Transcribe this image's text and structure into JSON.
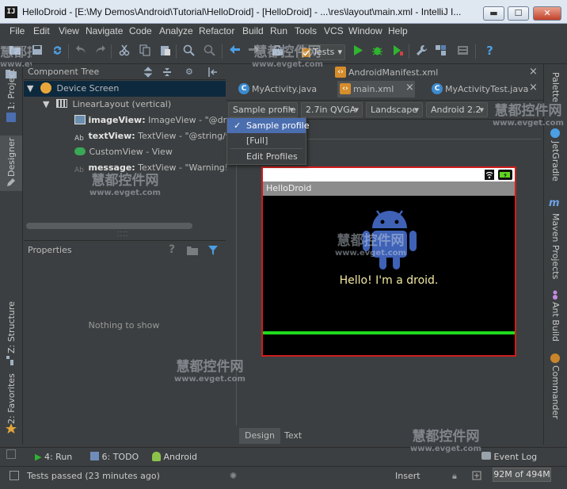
{
  "window": {
    "title": "HelloDroid - [E:\\My Demos\\Android\\Tutorial\\HelloDroid] - [HelloDroid] - ...\\res\\layout\\main.xml - IntelliJ I...",
    "app_icon_text": "IJ",
    "minimize": "▬",
    "maximize": "☐",
    "close": "✕"
  },
  "menu": [
    "File",
    "Edit",
    "View",
    "Navigate",
    "Code",
    "Analyze",
    "Refactor",
    "Build",
    "Run",
    "Tools",
    "VCS",
    "Window",
    "Help"
  ],
  "toolbar": {
    "run_config": "Tests",
    "help_icon": "?"
  },
  "left_strip": {
    "project": "1: Project",
    "designer": "Designer",
    "structure": "Z: Structure",
    "favorites": "2: Favorites"
  },
  "right_strip": {
    "palette": "Palette",
    "jetgradle": "JetGradle",
    "maven": "Maven Projects",
    "ant": "Ant Build",
    "commander": "Commander"
  },
  "component_tree": {
    "title": "Component Tree",
    "rows": [
      {
        "strong": "",
        "text": "Device Screen"
      },
      {
        "strong": "",
        "text": "LinearLayout (vertical)"
      },
      {
        "strong": "imageView:",
        "text": " ImageView - \"@drawa"
      },
      {
        "strong": "textView:",
        "text": " TextView - \"@string/welc"
      },
      {
        "strong": "",
        "text": "CustomView - View"
      },
      {
        "strong": "message:",
        "text": " TextView - \"Warning! Do"
      }
    ]
  },
  "properties": {
    "title": "Properties",
    "empty": "Nothing to show",
    "help": "?"
  },
  "editor_tabs": [
    {
      "label": "AndroidManifest.xml",
      "active": false
    },
    {
      "label": "MyActivity.java",
      "active": false
    },
    {
      "label": "main.xml",
      "active": true
    },
    {
      "label": "MyActivityTest.java",
      "active": false
    }
  ],
  "close_glyph": "×",
  "design_toolbar": {
    "profile": "Sample profile",
    "device": "2.7in QVGA",
    "orientation": "Landscape",
    "api": "Android 2.2"
  },
  "profile_menu": [
    {
      "label": "Sample profile",
      "checked": true
    },
    {
      "label": "[Full]",
      "checked": false
    },
    {
      "label": "Edit Profiles",
      "checked": false
    }
  ],
  "checkmark": "✓",
  "phone": {
    "app_title": "HelloDroid",
    "message": "Hello! I'm a droid."
  },
  "bottom_tabs": [
    {
      "label": "Design",
      "active": true
    },
    {
      "label": "Text",
      "active": false
    }
  ],
  "tool_windows": {
    "run": "4: Run",
    "todo": "6: TODO",
    "android": "Android",
    "event_log": "Event Log"
  },
  "status": {
    "message": "Tests passed (23 minutes ago)",
    "insert": "Insert",
    "memory": "92M of 494M"
  },
  "watermark": {
    "cn": "慧都控件网",
    "url": "www.evget.com"
  },
  "colors": {
    "selection": "#0d293e",
    "accent_blue": "#4b6eaf",
    "run_green": "#2fb52f",
    "phone_border": "#cf1d1d",
    "droid_blue": "#3f62b7"
  }
}
